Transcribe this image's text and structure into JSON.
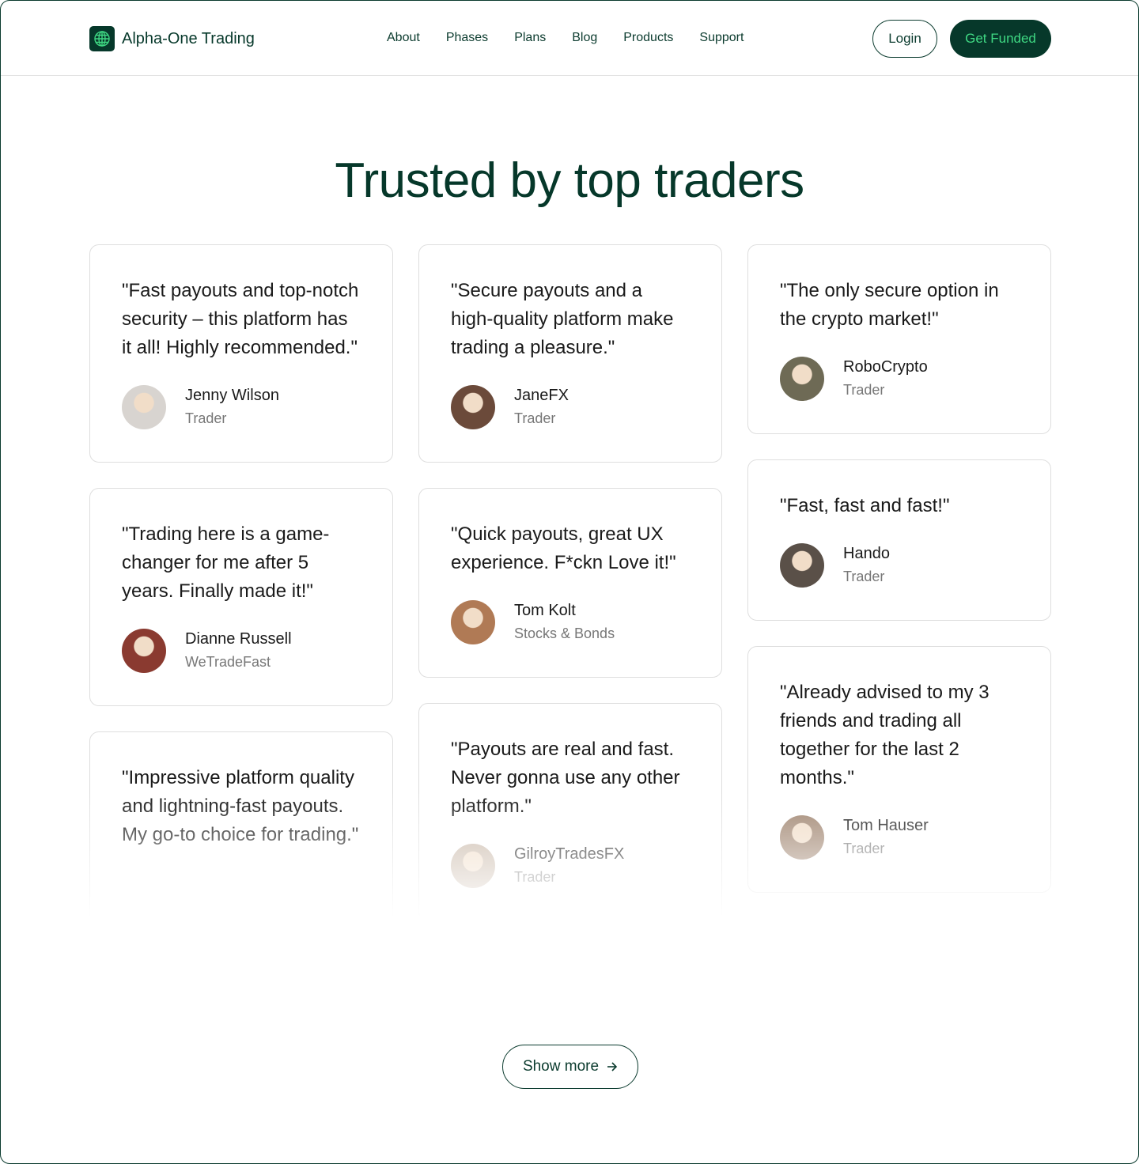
{
  "brand": {
    "name": "Alpha-One Trading",
    "icon": "globe-icon",
    "color": "#06382a",
    "accent": "#3fd883"
  },
  "nav": {
    "links": [
      "About",
      "Phases",
      "Plans",
      "Blog",
      "Products",
      "Support"
    ],
    "login": "Login",
    "cta": "Get Funded"
  },
  "heading": "Trusted by top traders",
  "columns": [
    [
      {
        "quote": "\"Fast payouts and top-notch security – this platform has it all! Highly recommended.\"",
        "name": "Jenny Wilson",
        "role": "Trader",
        "avatar_color": "#d8d4d0"
      },
      {
        "quote": "\"Trading here is a game-changer for me after 5 years. Finally made it!\"",
        "name": "Dianne Russell",
        "role": "WeTradeFast",
        "avatar_color": "#8a3a30"
      },
      {
        "quote": "\"Impressive platform quality and lightning-fast payouts. My go-to choice for trading.\"",
        "name": "",
        "role": "",
        "avatar_color": ""
      }
    ],
    [
      {
        "quote": "\"Secure payouts and a high-quality platform make trading a pleasure.\"",
        "name": "JaneFX",
        "role": "Trader",
        "avatar_color": "#6b4a3a"
      },
      {
        "quote": "\"Quick payouts, great UX experience. F*ckn Love it!\"",
        "name": "Tom Kolt",
        "role": "Stocks & Bonds",
        "avatar_color": "#b07a55"
      },
      {
        "quote": "\"Payouts are real and fast. Never gonna use any other platform.\"",
        "name": "GilroyTradesFX",
        "role": "Trader",
        "avatar_color": "#c9b8a8"
      }
    ],
    [
      {
        "quote": "\"The only secure option in the crypto market!\"",
        "name": "RoboCrypto",
        "role": "Trader",
        "avatar_color": "#6e6a55"
      },
      {
        "quote": "\"Fast, fast and fast!\"",
        "name": "Hando",
        "role": "Trader",
        "avatar_color": "#5a5048"
      },
      {
        "quote": "\"Already advised to my 3 friends and trading all together for the last 2 months.\"",
        "name": "Tom Hauser",
        "role": "Trader",
        "avatar_color": "#a08570"
      }
    ]
  ],
  "show_more": {
    "label": "Show more",
    "icon": "arrow-right-icon"
  }
}
